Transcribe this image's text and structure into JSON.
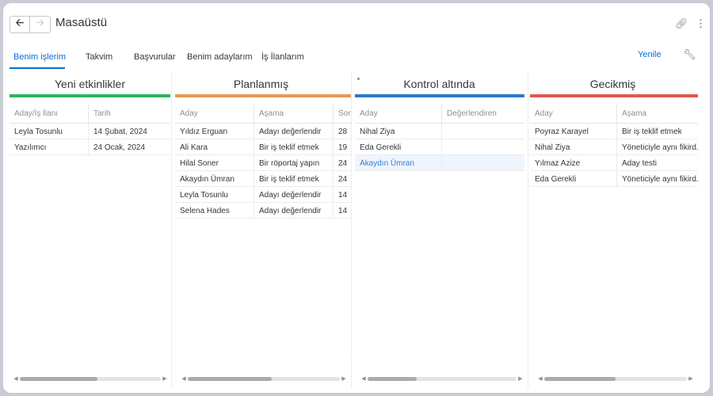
{
  "header": {
    "title": "Masaüstü"
  },
  "tabs": [
    "Benim işlerim",
    "Takvim",
    "Başvurular",
    "Benim adaylarım",
    "İş İlanlarım"
  ],
  "actions": {
    "refresh": "Yenile"
  },
  "icons": {
    "back": "arrow-left-icon",
    "forward": "arrow-right-icon",
    "link": "link-icon",
    "more": "more-vertical-icon",
    "settings": "wrench-icon"
  },
  "colors": {
    "accent": "#0a6ed1",
    "new": "#2eb35e",
    "planned": "#e79b50",
    "review": "#2979c8",
    "overdue": "#e0584f"
  },
  "columns": [
    {
      "title": "Yeni etkinlikler",
      "headers": [
        "Aday/İş İlanı",
        "Tarih"
      ],
      "rows": [
        [
          "Leyla Tosunlu",
          "14 Şubat, 2024"
        ],
        [
          "Yazılımcı",
          "24 Ocak, 2024"
        ]
      ],
      "scroll_fraction": 0.55
    },
    {
      "title": "Planlanmış",
      "headers": [
        "Aday",
        "Aşama",
        "Son"
      ],
      "rows": [
        [
          "Yıldız Erguan",
          "Adayı değerlendir",
          "28"
        ],
        [
          "Ali Kara",
          "Bir iş teklif etmek",
          "19"
        ],
        [
          "Hilal Soner",
          "Bir röportaj yapın",
          "24"
        ],
        [
          "Akaydın Ümran",
          "Bir iş teklif etmek",
          "24"
        ],
        [
          "Leyla Tosunlu",
          "Adayı değerlendir",
          "14"
        ],
        [
          "Selena Hades",
          "Adayı değerlendir",
          "14"
        ]
      ],
      "scroll_fraction": 0.55
    },
    {
      "title": "Kontrol altında",
      "headers": [
        "Aday",
        "Değerlendiren"
      ],
      "rows": [
        [
          "Nihal Ziya",
          ""
        ],
        [
          "Eda Gerekli",
          ""
        ],
        [
          "Akaydın Ümran",
          ""
        ]
      ],
      "selected_row": 2,
      "scroll_fraction": 0.33
    },
    {
      "title": "Gecikmiş",
      "headers": [
        "Aday",
        "Aşama"
      ],
      "rows": [
        [
          "Poyraz Karayel",
          "Bir iş teklif etmek"
        ],
        [
          "Nihal Ziya",
          "Yöneticiyle aynı fikird..."
        ],
        [
          "Yılmaz Azize",
          "Aday testi"
        ],
        [
          "Eda Gerekli",
          "Yöneticiyle aynı fikird..."
        ]
      ],
      "scroll_fraction": 0.5
    }
  ]
}
